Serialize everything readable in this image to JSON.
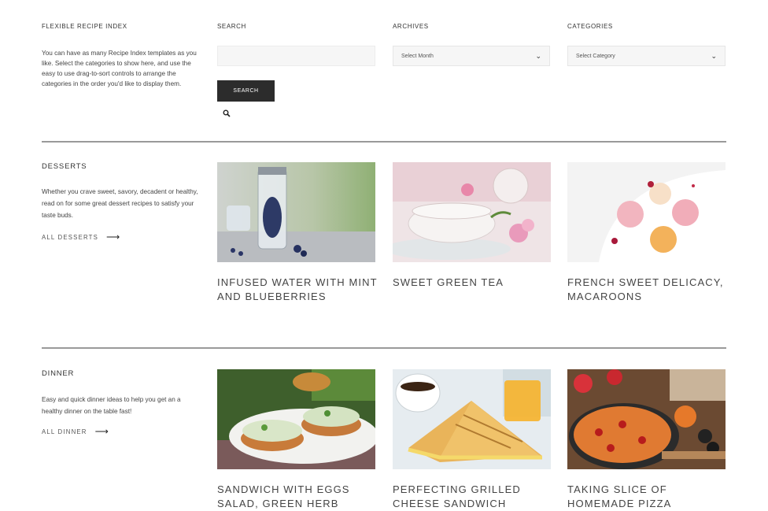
{
  "widgets": {
    "recipe_index": {
      "title": "FLEXIBLE RECIPE INDEX",
      "text": "You can have as many Recipe Index templates as you like. Select the categories to show here, and use the easy to use drag-to-sort controls to arrange the categories in the order you'd like to display them."
    },
    "search": {
      "title": "SEARCH",
      "placeholder": "",
      "button_label": "SEARCH",
      "icon": "search-icon"
    },
    "archives": {
      "title": "ARCHIVES",
      "selected": "Select Month"
    },
    "categories": {
      "title": "CATEGORIES",
      "selected": "Select Category"
    }
  },
  "sections": [
    {
      "title": "DESSERTS",
      "description": "Whether you crave sweet, savory, decadent or healthy, read on for some great dessert recipes to satisfy your taste buds.",
      "link": "ALL DESSERTS",
      "posts": [
        {
          "title": "INFUSED WATER WITH MINT AND BLUEBERRIES"
        },
        {
          "title": "SWEET GREEN TEA"
        },
        {
          "title": "FRENCH SWEET DELICACY, MACAROONS"
        }
      ]
    },
    {
      "title": "DINNER",
      "description": "Easy and quick dinner ideas to help you get an a healthy dinner on the table fast!",
      "link": "ALL DINNER",
      "posts": [
        {
          "title": "SANDWICH WITH EGGS SALAD, GREEN HERB"
        },
        {
          "title": "PERFECTING GRILLED CHEESE SANDWICH"
        },
        {
          "title": "TAKING SLICE OF HOMEMADE PIZZA"
        }
      ]
    }
  ],
  "colors": {
    "button": "#2c2c2c",
    "rule": "#9a9a9a",
    "text": "#333333"
  }
}
